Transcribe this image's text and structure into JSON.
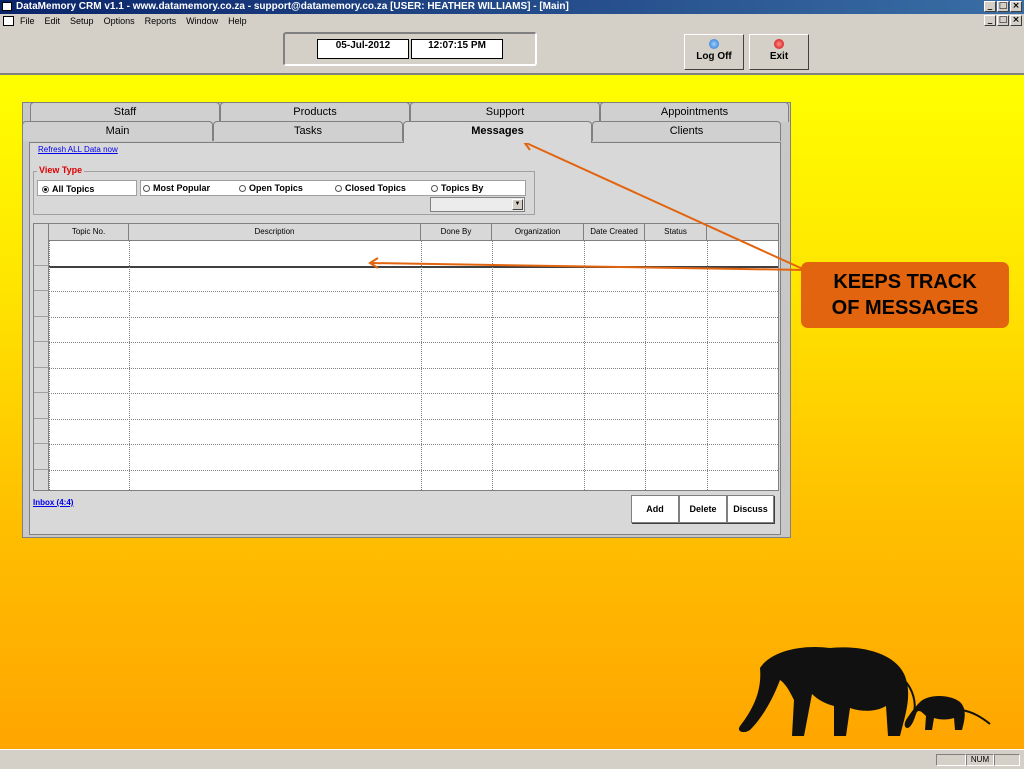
{
  "window": {
    "title": "DataMemory CRM v1.1 - www.datamemory.co.za - support@datamemory.co.za [USER: HEATHER WILLIAMS] - [Main]",
    "controls": [
      "_",
      "□",
      "×"
    ]
  },
  "menu": {
    "items": [
      "File",
      "Edit",
      "Setup",
      "Options",
      "Reports",
      "Window",
      "Help"
    ]
  },
  "toolbar": {
    "date": "05-Jul-2012",
    "time": "12:07:15 PM",
    "logoff_label": "Log Off",
    "exit_label": "Exit"
  },
  "tabs": {
    "row1": [
      "Staff",
      "Products",
      "Support",
      "Appointments"
    ],
    "row2": [
      "Main",
      "Tasks",
      "Messages",
      "Clients"
    ],
    "active": "Messages"
  },
  "messages": {
    "refresh_link": "Refresh ALL Data now",
    "view_type_label": "View Type",
    "view_options": [
      "All Topics",
      "Most Popular",
      "Open Topics",
      "Closed Topics",
      "Topics By"
    ],
    "selected_option": "All Topics",
    "columns": [
      "Topic No.",
      "Description",
      "Done By",
      "Organization",
      "Date Created",
      "Status"
    ],
    "inbox_link": "Inbox (4:4)",
    "buttons": {
      "add": "Add",
      "delete": "Delete",
      "discuss": "Discuss"
    }
  },
  "callout": {
    "line1": "KEEPS TRACK",
    "line2": "OF MESSAGES",
    "color": "#e2640e"
  },
  "statusbar": {
    "num": "NUM"
  },
  "colors": {
    "title_bar": "#0a246a",
    "accent_red": "#e00000",
    "link": "#0000ee",
    "arrow": "#e2640e"
  }
}
